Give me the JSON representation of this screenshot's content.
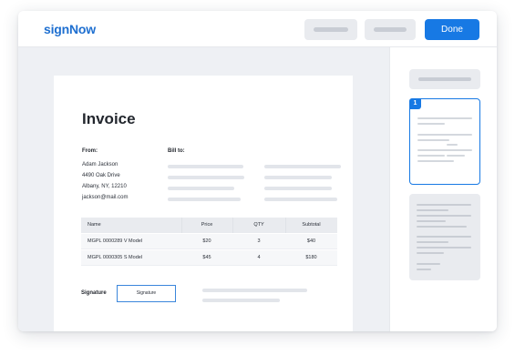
{
  "app": {
    "logo": "signNow",
    "done_label": "Done",
    "accent_color": "#1779e4"
  },
  "invoice": {
    "title": "Invoice",
    "from_label": "From:",
    "bill_to_label": "Bill to:",
    "from_lines": [
      "Adam Jackson",
      "4490 Oak Drive",
      "Albany, NY, 12210",
      "jackson@mail.com"
    ],
    "table": {
      "headers": [
        "Name",
        "Price",
        "QTY",
        "Subtotal"
      ],
      "rows": [
        [
          "MGPL 0000289 V Model",
          "$20",
          "3",
          "$40"
        ],
        [
          "MGPL 0000305 S Model",
          "$45",
          "4",
          "$180"
        ]
      ]
    },
    "signature_label": "Signature",
    "signature_field_text": "Signature"
  },
  "sidebar": {
    "active_page_number": "1"
  }
}
